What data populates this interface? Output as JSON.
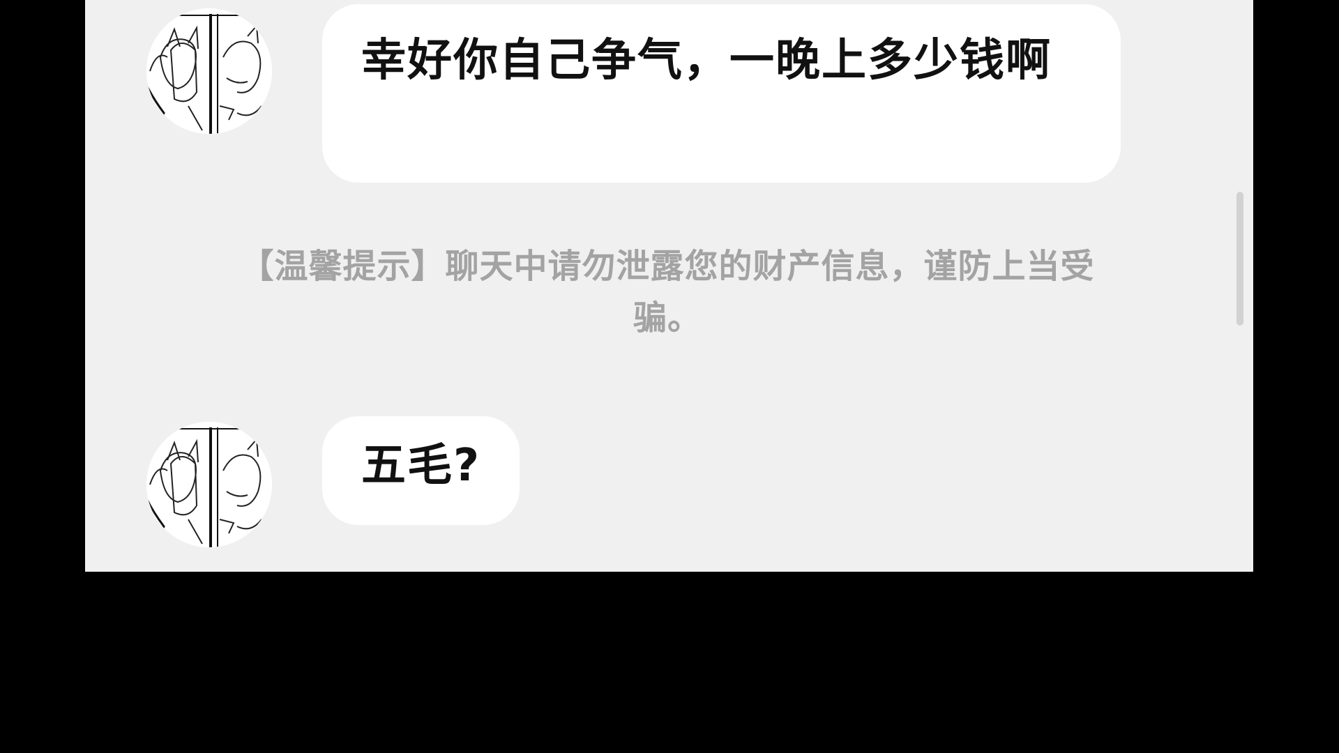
{
  "messages": [
    {
      "text": "幸好你自己争气，一晚上多少钱啊"
    },
    {
      "text": "五毛?"
    }
  ],
  "system_tip": {
    "text": "【温馨提示】聊天中请勿泄露您的财产信息，谨防上当受骗。"
  },
  "colors": {
    "background": "#000000",
    "chat_area": "#f0f0f0",
    "bubble": "#ffffff",
    "message_text": "#111111",
    "tip_text": "#a3a3a3"
  }
}
